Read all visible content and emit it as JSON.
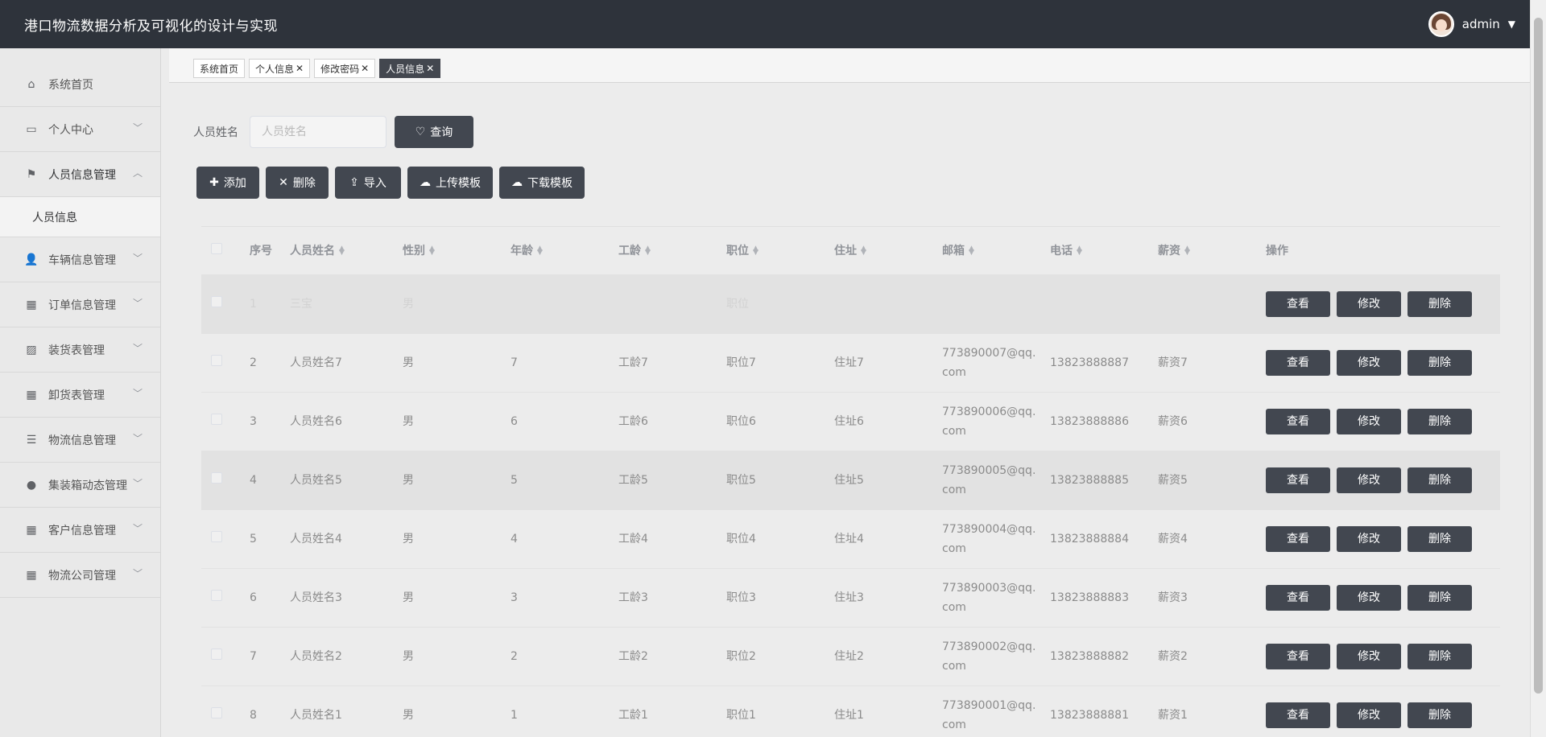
{
  "header": {
    "title": "港口物流数据分析及可视化的设计与实现",
    "user": "admin"
  },
  "sidebar": {
    "items": [
      {
        "label": "系统首页",
        "icon": "home-icon"
      },
      {
        "label": "个人中心",
        "icon": "card-icon"
      },
      {
        "label": "人员信息管理",
        "icon": "flag-icon"
      },
      {
        "label": "车辆信息管理",
        "icon": "user-icon"
      },
      {
        "label": "订单信息管理",
        "icon": "grid-icon"
      },
      {
        "label": "装货表管理",
        "icon": "chart-icon"
      },
      {
        "label": "卸货表管理",
        "icon": "grid-icon"
      },
      {
        "label": "物流信息管理",
        "icon": "list-icon"
      },
      {
        "label": "集装箱动态管理",
        "icon": "balloon-icon"
      },
      {
        "label": "客户信息管理",
        "icon": "grid-icon"
      },
      {
        "label": "物流公司管理",
        "icon": "grid-icon"
      }
    ],
    "sub_item": "人员信息"
  },
  "tabs": [
    {
      "label": "系统首页"
    },
    {
      "label": "个人信息"
    },
    {
      "label": "修改密码"
    },
    {
      "label": "人员信息"
    }
  ],
  "search": {
    "label": "人员姓名",
    "placeholder": "人员姓名",
    "button": "查询"
  },
  "toolbar": {
    "add": "添加",
    "delete": "删除",
    "import": "导入",
    "upload": "上传模板",
    "download": "下载模板"
  },
  "table": {
    "headers": [
      "序号",
      "人员姓名",
      "性别",
      "年龄",
      "工龄",
      "职位",
      "住址",
      "邮箱",
      "电话",
      "薪资",
      "操作"
    ],
    "rows": [
      {
        "index": "1",
        "name": "三宝",
        "gender": "男",
        "age": "",
        "seniority": "",
        "position": "职位",
        "address": "",
        "email": "",
        "phone": "",
        "salary": ""
      },
      {
        "index": "2",
        "name": "人员姓名7",
        "gender": "男",
        "age": "7",
        "seniority": "工龄7",
        "position": "职位7",
        "address": "住址7",
        "email": "773890007@qq.com",
        "phone": "13823888887",
        "salary": "薪资7"
      },
      {
        "index": "3",
        "name": "人员姓名6",
        "gender": "男",
        "age": "6",
        "seniority": "工龄6",
        "position": "职位6",
        "address": "住址6",
        "email": "773890006@qq.com",
        "phone": "13823888886",
        "salary": "薪资6"
      },
      {
        "index": "4",
        "name": "人员姓名5",
        "gender": "男",
        "age": "5",
        "seniority": "工龄5",
        "position": "职位5",
        "address": "住址5",
        "email": "773890005@qq.com",
        "phone": "13823888885",
        "salary": "薪资5"
      },
      {
        "index": "5",
        "name": "人员姓名4",
        "gender": "男",
        "age": "4",
        "seniority": "工龄4",
        "position": "职位4",
        "address": "住址4",
        "email": "773890004@qq.com",
        "phone": "13823888884",
        "salary": "薪资4"
      },
      {
        "index": "6",
        "name": "人员姓名3",
        "gender": "男",
        "age": "3",
        "seniority": "工龄3",
        "position": "职位3",
        "address": "住址3",
        "email": "773890003@qq.com",
        "phone": "13823888883",
        "salary": "薪资3"
      },
      {
        "index": "7",
        "name": "人员姓名2",
        "gender": "男",
        "age": "2",
        "seniority": "工龄2",
        "position": "职位2",
        "address": "住址2",
        "email": "773890002@qq.com",
        "phone": "13823888882",
        "salary": "薪资2"
      },
      {
        "index": "8",
        "name": "人员姓名1",
        "gender": "男",
        "age": "1",
        "seniority": "工龄1",
        "position": "职位1",
        "address": "住址1",
        "email": "773890001@qq.com",
        "phone": "13823888881",
        "salary": "薪资1"
      }
    ],
    "actions": {
      "view": "查看",
      "edit": "修改",
      "delete": "删除"
    }
  },
  "colors": {
    "header_bg": "#2e333b",
    "button_bg": "#424750",
    "sidebar_bg": "#e9e9e9"
  }
}
